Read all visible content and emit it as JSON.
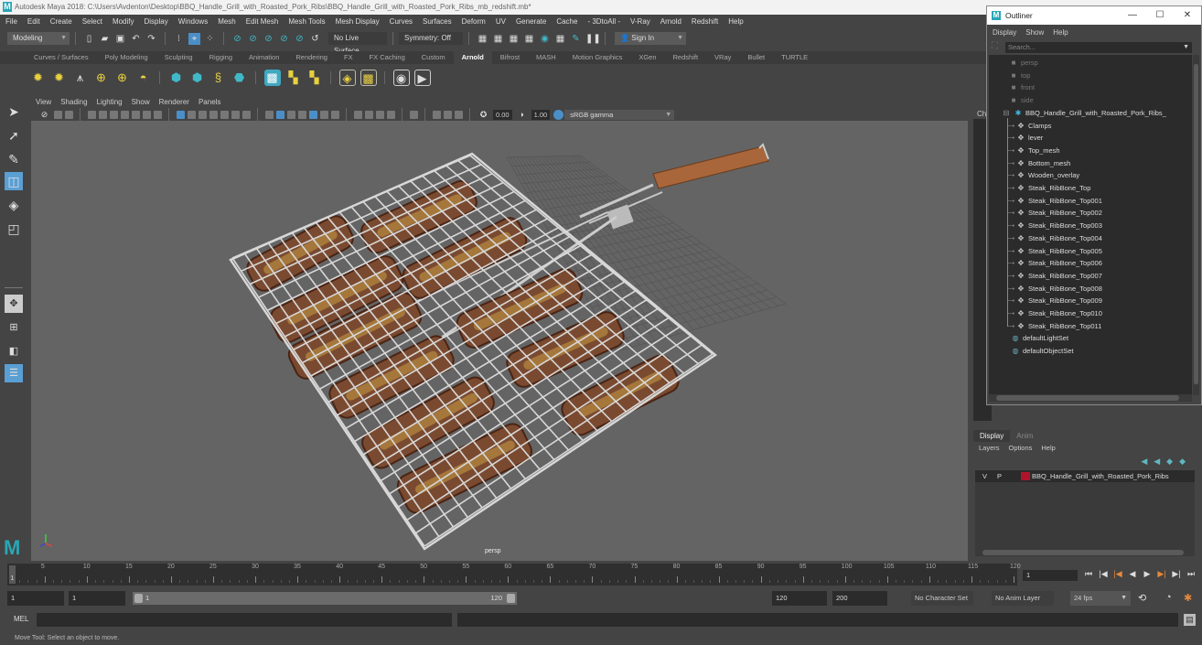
{
  "window": {
    "title": "Autodesk Maya 2018: C:\\Users\\Avdenton\\Desktop\\BBQ_Handle_Grill_with_Roasted_Pork_Ribs\\BBQ_Handle_Grill_with_Roasted_Pork_Ribs_mb_redshift.mb*",
    "logo": "M"
  },
  "menubar": [
    "File",
    "Edit",
    "Create",
    "Select",
    "Modify",
    "Display",
    "Windows",
    "Mesh",
    "Edit Mesh",
    "Mesh Tools",
    "Mesh Display",
    "Curves",
    "Surfaces",
    "Deform",
    "UV",
    "Generate",
    "Cache",
    "- 3DtoAll -",
    "V-Ray",
    "Arnold",
    "Redshift",
    "Help"
  ],
  "statusline": {
    "mode": "Modeling",
    "live_surface": "No Live Surface",
    "symmetry": "Symmetry: Off",
    "sign_in": "Sign In"
  },
  "shelf": {
    "tabs": [
      "Curves / Surfaces",
      "Poly Modeling",
      "Sculpting",
      "Rigging",
      "Animation",
      "Rendering",
      "FX",
      "FX Caching",
      "Custom",
      "Arnold",
      "Bifrost",
      "MASH",
      "Motion Graphics",
      "XGen",
      "Redshift",
      "VRay",
      "Bullet",
      "TURTLE"
    ],
    "active_tab": "Arnold",
    "icons": [
      "area-light-icon",
      "skydome-light-icon",
      "spot-light-icon",
      "sphere-light-icon",
      "mesh-light-icon",
      "physical-sky-icon",
      "create-standin-icon",
      "standin-export-icon",
      "curve-collector-icon",
      "volume-icon",
      "render-view-icon",
      "texture-icon",
      "tx-manager-icon",
      "light-editor-icon",
      "render-settings-icon",
      "ipr-icon",
      "render-icon"
    ]
  },
  "viewport": {
    "menu": [
      "View",
      "Shading",
      "Lighting",
      "Show",
      "Renderer",
      "Panels"
    ],
    "exposure": "0.00",
    "gamma": "1.00",
    "color_space": "sRGB gamma",
    "camera_label": "persp"
  },
  "channel_box": {
    "label": "Ch"
  },
  "outliner": {
    "title": "Outliner",
    "menu": [
      "Display",
      "Show",
      "Help"
    ],
    "search_placeholder": "Search...",
    "cameras": [
      "persp",
      "top",
      "front",
      "side"
    ],
    "root": "BBQ_Handle_Grill_with_Roasted_Pork_Ribs_",
    "children": [
      "Clamps",
      "lever",
      "Top_mesh",
      "Bottom_mesh",
      "Wooden_overlay",
      "Steak_RibBone_Top",
      "Steak_RibBone_Top001",
      "Steak_RibBone_Top002",
      "Steak_RibBone_Top003",
      "Steak_RibBone_Top004",
      "Steak_RibBone_Top005",
      "Steak_RibBone_Top006",
      "Steak_RibBone_Top007",
      "Steak_RibBone_Top008",
      "Steak_RibBone_Top009",
      "Steak_RibBone_Top010",
      "Steak_RibBone_Top011"
    ],
    "sets": [
      "defaultLightSet",
      "defaultObjectSet"
    ]
  },
  "layers": {
    "tabs": [
      "Display",
      "Anim"
    ],
    "menu": [
      "Layers",
      "Options",
      "Help"
    ],
    "row": {
      "v": "V",
      "p": "P",
      "name": "BBQ_Handle_Grill_with_Roasted_Pork_Ribs",
      "color": "#b0142c"
    }
  },
  "timeline": {
    "ticks": [
      "5",
      "10",
      "15",
      "20",
      "25",
      "30",
      "35",
      "40",
      "45",
      "50",
      "55",
      "60",
      "65",
      "70",
      "75",
      "80",
      "85",
      "90",
      "95",
      "100",
      "105",
      "110",
      "115",
      "120"
    ],
    "current_frame": "1",
    "current_marker": "1"
  },
  "range": {
    "start": "1",
    "playback_start": "1",
    "slider_start": "1",
    "slider_end": "120",
    "playback_end": "120",
    "end": "200",
    "character_set": "No Character Set",
    "anim_layer": "No Anim Layer",
    "fps": "24 fps"
  },
  "command": {
    "label": "MEL"
  },
  "help_line": "Move Tool: Select an object to move."
}
